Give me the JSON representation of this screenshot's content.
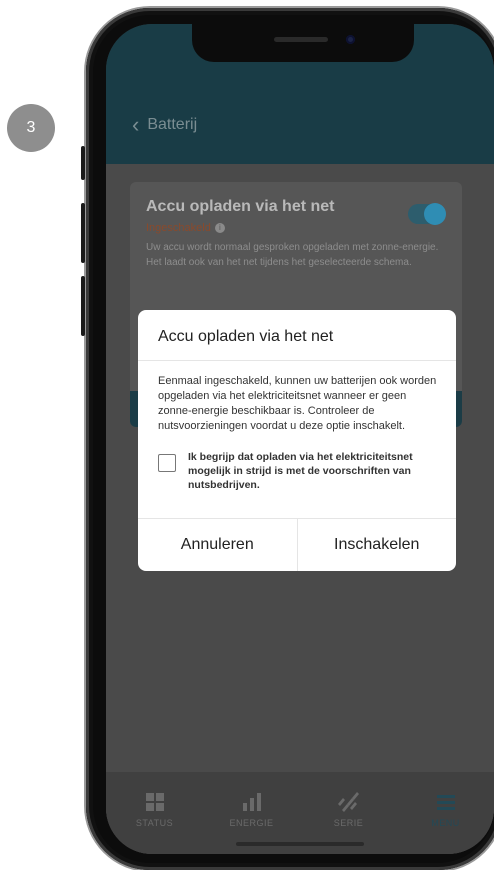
{
  "step": {
    "number": "3"
  },
  "header": {
    "back_label": "Batterij"
  },
  "card": {
    "title": "Accu opladen via het net",
    "status": "Ingeschakeld",
    "description": "Uw accu wordt normaal gesproken opgeladen met zonne-energie. Het laadt ook van het net tijdens het geselecteerde schema.",
    "toggle_on": true
  },
  "modal": {
    "title": "Accu opladen via het net",
    "body": "Eenmaal ingeschakeld, kunnen uw batterijen ook worden opgeladen via het elektriciteitsnet wanneer er geen zonne-energie beschikbaar is. Controleer de nutsvoorzieningen voordat u deze optie inschakelt.",
    "consent": "Ik begrijp dat opladen via het elektriciteitsnet mogelijk in strijd is met de voorschriften van nutsbedrijven.",
    "cancel_label": "Annuleren",
    "confirm_label": "Inschakelen"
  },
  "tabbar": {
    "items": [
      {
        "label": "STATUS",
        "icon": "grid-icon"
      },
      {
        "label": "ENERGIE",
        "icon": "bar-chart-icon"
      },
      {
        "label": "SERIE",
        "icon": "series-icon"
      },
      {
        "label": "MENU",
        "icon": "menu-icon"
      }
    ]
  },
  "colors": {
    "header": "#193c46",
    "accent": "#2f8db4",
    "status": "#8a4a2c"
  }
}
